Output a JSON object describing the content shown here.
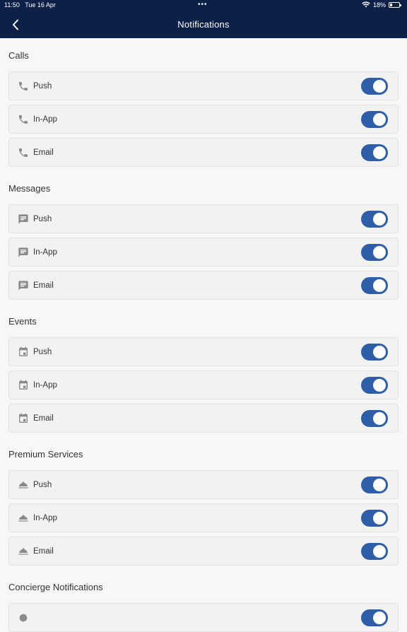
{
  "status_bar": {
    "time": "11:50",
    "date": "Tue 16 Apr",
    "battery": "18%",
    "multitask_dots": "•••"
  },
  "header": {
    "title": "Notifications",
    "back_icon": "chevron-left-icon",
    "background": "#0d2048"
  },
  "accent": "#2f5ea8",
  "sections": [
    {
      "title": "Calls",
      "icon": "phone-icon",
      "items": [
        {
          "label": "Push",
          "enabled": true
        },
        {
          "label": "In-App",
          "enabled": true
        },
        {
          "label": "Email",
          "enabled": true
        }
      ]
    },
    {
      "title": "Messages",
      "icon": "message-icon",
      "items": [
        {
          "label": "Push",
          "enabled": true
        },
        {
          "label": "In-App",
          "enabled": true
        },
        {
          "label": "Email",
          "enabled": true
        }
      ]
    },
    {
      "title": "Events",
      "icon": "calendar-icon",
      "items": [
        {
          "label": "Push",
          "enabled": true
        },
        {
          "label": "In-App",
          "enabled": true
        },
        {
          "label": "Email",
          "enabled": true
        }
      ]
    },
    {
      "title": "Premium Services",
      "icon": "cloche-icon",
      "items": [
        {
          "label": "Push",
          "enabled": true
        },
        {
          "label": "In-App",
          "enabled": true
        },
        {
          "label": "Email",
          "enabled": true
        }
      ]
    },
    {
      "title": "Concierge Notifications",
      "icon": "concierge-icon",
      "items": [
        {
          "label": "",
          "enabled": true
        }
      ]
    }
  ]
}
